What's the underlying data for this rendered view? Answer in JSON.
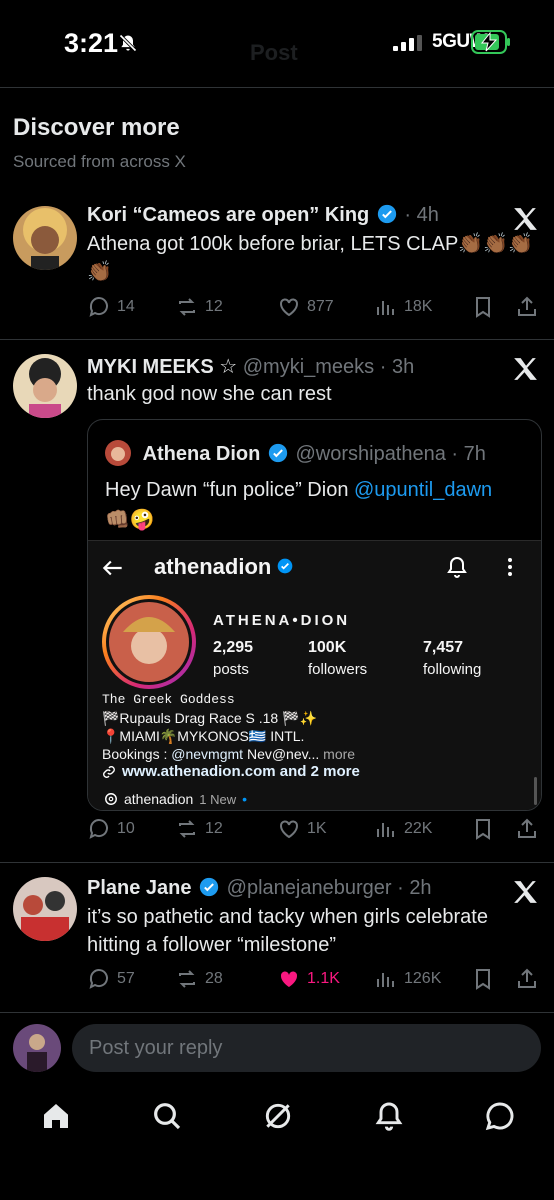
{
  "status_bar": {
    "time": "3:21",
    "network": "5GUW",
    "ghost_title": "Post"
  },
  "discover": {
    "title": "Discover more",
    "subtitle": "Sourced from across X"
  },
  "posts": [
    {
      "name": "Kori “Cameos are open” King",
      "handle": "",
      "time": "4h",
      "text": "Athena got 100k before briar, LETS CLAP👏🏾👏🏾👏🏾👏🏾",
      "replies": "14",
      "reposts": "12",
      "likes": "877",
      "views": "18K"
    },
    {
      "name": "MYKI MEEKS ☆",
      "handle": "@myki_meeks",
      "time": "3h",
      "text": "thank god now she can rest",
      "replies": "10",
      "reposts": "12",
      "likes": "1K",
      "views": "22K",
      "quote": {
        "name": "Athena Dion",
        "handle": "@worshipathena",
        "time": "7h",
        "text_prefix": "Hey Dawn “fun police” Dion ",
        "mention": "@upuntil_dawn",
        "emoji": "👊🏽🤪",
        "instagram": {
          "username": "athenadion",
          "full_name": "ATHENA•DION",
          "posts_count": "2,295",
          "posts_label": "posts",
          "followers_count": "100K",
          "followers_label": "followers",
          "following_count": "7,457",
          "following_label": "following",
          "bio_line1": "The Greek Goddess",
          "bio_line2": "🏁Rupauls Drag Race S .18 🏁✨",
          "bio_line3": "📍MIAMI🌴MYKONOS🇬🇷 INTL.",
          "bio_bookings_label": "Bookings : ",
          "bio_bookings_mention": "@nevmgmt",
          "bio_bookings_rest": "  Nev@nev...",
          "bio_more": " more",
          "link": "www.athenadion.com and 2 more",
          "threads_name": "athenadion",
          "threads_new": "1 New"
        }
      }
    },
    {
      "name": "Plane Jane",
      "handle": "@planejaneburger",
      "time": "2h",
      "text": "it’s so pathetic and tacky when girls celebrate hitting a follower “milestone”",
      "replies": "57",
      "reposts": "28",
      "likes": "1.1K",
      "views": "126K"
    }
  ],
  "reply_box": {
    "placeholder": "Post your reply"
  },
  "colors": {
    "accent": "#1d9bf0",
    "like": "#f91880",
    "muted": "#71767b",
    "battery": "#34c759"
  },
  "icons": [
    "home-icon",
    "search-icon",
    "grok-icon",
    "notifications-icon",
    "messages-icon"
  ]
}
